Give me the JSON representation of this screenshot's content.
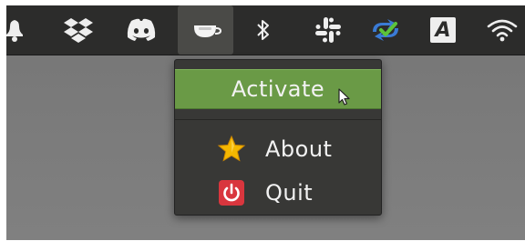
{
  "top_panel": {
    "tray_icons": [
      {
        "name": "notifications-bell-icon"
      },
      {
        "name": "dropbox-icon"
      },
      {
        "name": "discord-icon"
      },
      {
        "name": "caffeine-cup-icon",
        "active": true
      },
      {
        "name": "bluetooth-icon"
      },
      {
        "name": "slack-icon"
      },
      {
        "name": "sync-status-icon"
      },
      {
        "name": "input-method-icon",
        "label": "A"
      },
      {
        "name": "wifi-icon"
      }
    ]
  },
  "menu": {
    "activate_label": "Activate",
    "about_label": "About",
    "quit_label": "Quit"
  },
  "colors": {
    "panel_background": "#2c2c2b",
    "menu_background": "#383836",
    "highlight_green": "#6a9a46",
    "quit_red": "#d9363e",
    "about_star": "#f5b800"
  }
}
